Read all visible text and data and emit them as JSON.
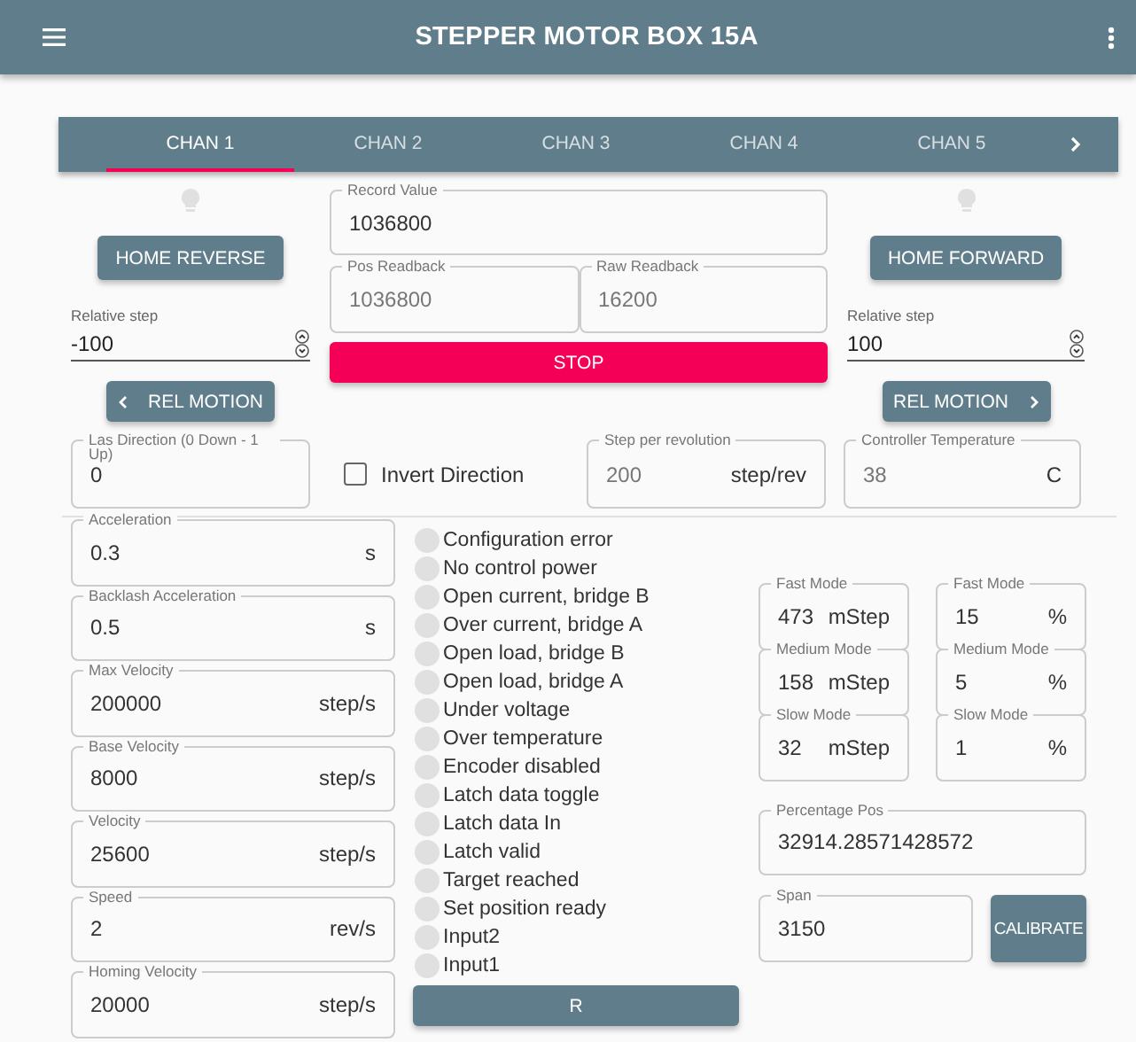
{
  "app_bar": {
    "title": "STEPPER MOTOR BOX 15A"
  },
  "tabs": [
    {
      "label": "CHAN 1",
      "selected": true
    },
    {
      "label": "CHAN 2",
      "selected": false
    },
    {
      "label": "CHAN 3",
      "selected": false
    },
    {
      "label": "CHAN 4",
      "selected": false
    },
    {
      "label": "CHAN 5",
      "selected": false
    }
  ],
  "left_panel": {
    "home_button": "HOME REVERSE",
    "relative_step": {
      "label": "Relative step",
      "value": "-100"
    },
    "rel_motion_button": "REL MOTION"
  },
  "center_panel": {
    "record_value": {
      "label": "Record Value",
      "value": "1036800",
      "disabled": false
    },
    "readbacks": [
      {
        "label": "Pos Readback",
        "value": "1036800",
        "disabled": true
      },
      {
        "label": "Raw Readback",
        "value": "16200",
        "disabled": true
      }
    ],
    "stop_button": "STOP"
  },
  "right_panel": {
    "home_button": "HOME FORWARD",
    "relative_step": {
      "label": "Relative step",
      "value": "100"
    },
    "rel_motion_button": "REL MOTION"
  },
  "direction": {
    "label": "Las Direction (0 Down - 1 Up)",
    "value": "0",
    "disabled": false
  },
  "invert_direction": {
    "label": "Invert Direction",
    "checked": false
  },
  "step_per_revolution": {
    "label": "Step per revolution",
    "value": "200",
    "unit": "step/rev",
    "disabled": true
  },
  "controller_temperature": {
    "label": "Controller Temperature",
    "value": "38",
    "unit": "C",
    "disabled": true
  },
  "motion_settings": [
    {
      "label": "Acceleration",
      "value": "0.3",
      "unit": "s"
    },
    {
      "label": "Backlash Acceleration",
      "value": "0.5",
      "unit": "s"
    },
    {
      "label": "Max Velocity",
      "value": "200000",
      "unit": "step/s"
    },
    {
      "label": "Base Velocity",
      "value": "8000",
      "unit": "step/s"
    },
    {
      "label": "Velocity",
      "value": "25600",
      "unit": "step/s"
    },
    {
      "label": "Speed",
      "value": "2",
      "unit": "rev/s"
    },
    {
      "label": "Homing Velocity",
      "value": "20000",
      "unit": "step/s"
    }
  ],
  "status_flags": [
    {
      "label": "Configuration error",
      "on": false
    },
    {
      "label": "No control power",
      "on": false
    },
    {
      "label": "Open current, bridge B",
      "on": false
    },
    {
      "label": "Over current, bridge A",
      "on": false
    },
    {
      "label": "Open load, bridge B",
      "on": false
    },
    {
      "label": "Open load, bridge A",
      "on": false
    },
    {
      "label": "Under voltage",
      "on": false
    },
    {
      "label": "Over temperature",
      "on": false
    },
    {
      "label": "Encoder disabled",
      "on": false
    },
    {
      "label": "Latch data toggle",
      "on": false
    },
    {
      "label": "Latch data In",
      "on": false
    },
    {
      "label": "Latch valid",
      "on": false
    },
    {
      "label": "Target reached",
      "on": false
    },
    {
      "label": "Set position ready",
      "on": false
    },
    {
      "label": "Input2",
      "on": false
    },
    {
      "label": "Input1",
      "on": false
    }
  ],
  "reset_button": "R",
  "mode_steps": [
    {
      "label": "Fast Mode",
      "value": "473",
      "unit": "mStep"
    },
    {
      "label": "Medium Mode",
      "value": "158",
      "unit": "mStep"
    },
    {
      "label": "Slow Mode",
      "value": "32",
      "unit": "mStep"
    }
  ],
  "mode_percents": [
    {
      "label": "Fast Mode",
      "value": "15",
      "unit": "%"
    },
    {
      "label": "Medium Mode",
      "value": "5",
      "unit": "%"
    },
    {
      "label": "Slow Mode",
      "value": "1",
      "unit": "%"
    }
  ],
  "percentage_pos": {
    "label": "Percentage Pos",
    "value": "32914.28571428572"
  },
  "span": {
    "label": "Span",
    "value": "3150"
  },
  "calibrate_button": "CALIBRATE"
}
